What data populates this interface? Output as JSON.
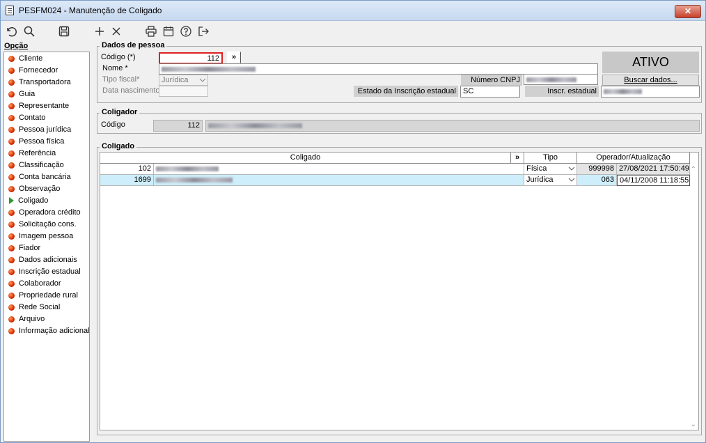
{
  "window": {
    "title": "PESFM024 - Manutenção de Coligado",
    "close_label": "✕"
  },
  "toolbar": {
    "icons": [
      "undo-icon",
      "search-icon",
      "save-icon",
      "add-icon",
      "delete-icon",
      "print-icon",
      "calendar-icon",
      "help-icon",
      "exit-icon"
    ]
  },
  "sidebar": {
    "title": "Opção",
    "items": [
      {
        "label": "Cliente"
      },
      {
        "label": "Fornecedor"
      },
      {
        "label": "Transportadora"
      },
      {
        "label": "Guia"
      },
      {
        "label": "Representante"
      },
      {
        "label": "Contato"
      },
      {
        "label": "Pessoa jurídica"
      },
      {
        "label": "Pessoa física"
      },
      {
        "label": "Referência"
      },
      {
        "label": "Classificação"
      },
      {
        "label": "Conta bancária"
      },
      {
        "label": "Observação"
      },
      {
        "label": "Coligado"
      },
      {
        "label": "Operadora crédito"
      },
      {
        "label": "Solicitação cons."
      },
      {
        "label": "Imagem pessoa"
      },
      {
        "label": "Fiador"
      },
      {
        "label": "Dados adicionais"
      },
      {
        "label": "Inscrição estadual"
      },
      {
        "label": "Colaborador"
      },
      {
        "label": "Propriedade rural"
      },
      {
        "label": "Rede Social"
      },
      {
        "label": "Arquivo"
      },
      {
        "label": "Informação adicional"
      }
    ],
    "active_index": 12
  },
  "dados_pessoa": {
    "title": "Dados de pessoa",
    "codigo_label": "Código (*)",
    "codigo_value": "112",
    "expand_label": "»",
    "nome_label": "Nome *",
    "tipo_fiscal_label": "Tipo fiscal*",
    "tipo_fiscal_value": "Jurídica",
    "data_nascimento_label": "Data nascimento",
    "numero_cnpj_label": "Número CNPJ",
    "estado_inscricao_label": "Estado da Inscrição estadual",
    "estado_inscricao_value": "SC",
    "inscr_estadual_label": "Inscr. estadual",
    "status": "ATIVO",
    "buscar_label": "Buscar dados..."
  },
  "coligador": {
    "title": "Coligador",
    "codigo_label": "Código",
    "codigo_value": "112"
  },
  "coligado": {
    "title": "Coligado",
    "columns": {
      "coligado": "Coligado",
      "expand": "»",
      "tipo": "Tipo",
      "operador": "Operador/Atualização"
    },
    "rows": [
      {
        "code": "102",
        "tipo": "Física",
        "operador": "999998",
        "atualizacao": "27/08/2021 17:50:49"
      },
      {
        "code": "1699",
        "tipo": "Jurídica",
        "operador": "063",
        "atualizacao": "04/11/2008 11:18:55"
      }
    ]
  }
}
